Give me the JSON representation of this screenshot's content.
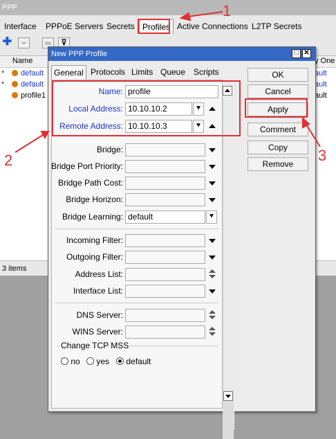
{
  "window_title": "PPP",
  "tabs": [
    "Interface",
    "PPPoE Servers",
    "Secrets",
    "Profiles",
    "Active Connections",
    "L2TP Secrets"
  ],
  "list": {
    "col_name": "Name",
    "col_right": "y One",
    "rows": [
      {
        "star": "*",
        "name": "default",
        "right": "ault"
      },
      {
        "star": "*",
        "name": "default",
        "right": "ault"
      },
      {
        "star": "",
        "name": "profile1",
        "right": "ault"
      }
    ],
    "status": "3 items"
  },
  "dialog": {
    "title": "New PPP Profile",
    "tabs": [
      "General",
      "Protocols",
      "Limits",
      "Queue",
      "Scripts"
    ],
    "fields": {
      "name_label": "Name:",
      "name_value": "profile",
      "local_label": "Local Address:",
      "local_value": "10.10.10.2",
      "remote_label": "Remote Address:",
      "remote_value": "10.10.10.3",
      "bridge_label": "Bridge:",
      "bridge_port_priority_label": "Bridge Port Priority:",
      "bridge_path_cost_label": "Bridge Path Cost:",
      "bridge_horizon_label": "Bridge Horizon:",
      "bridge_learning_label": "Bridge Learning:",
      "bridge_learning_value": "default",
      "incoming_filter_label": "Incoming Filter:",
      "outgoing_filter_label": "Outgoing Filter:",
      "address_list_label": "Address List:",
      "interface_list_label": "Interface List:",
      "dns_server_label": "DNS Server:",
      "wins_server_label": "WINS Server:",
      "tcp_mss_group": "Change TCP MSS",
      "tcp_mss_options": [
        "no",
        "yes",
        "default"
      ],
      "tcp_mss_selected": "default"
    },
    "buttons": {
      "ok": "OK",
      "cancel": "Cancel",
      "apply": "Apply",
      "comment": "Comment",
      "copy": "Copy",
      "remove": "Remove"
    }
  },
  "annotations": {
    "one": "1",
    "two": "2",
    "three": "3"
  },
  "colors": {
    "title_blue": "#3468c6",
    "annotation_red": "#e03131",
    "label_blue": "#1b34c9"
  }
}
